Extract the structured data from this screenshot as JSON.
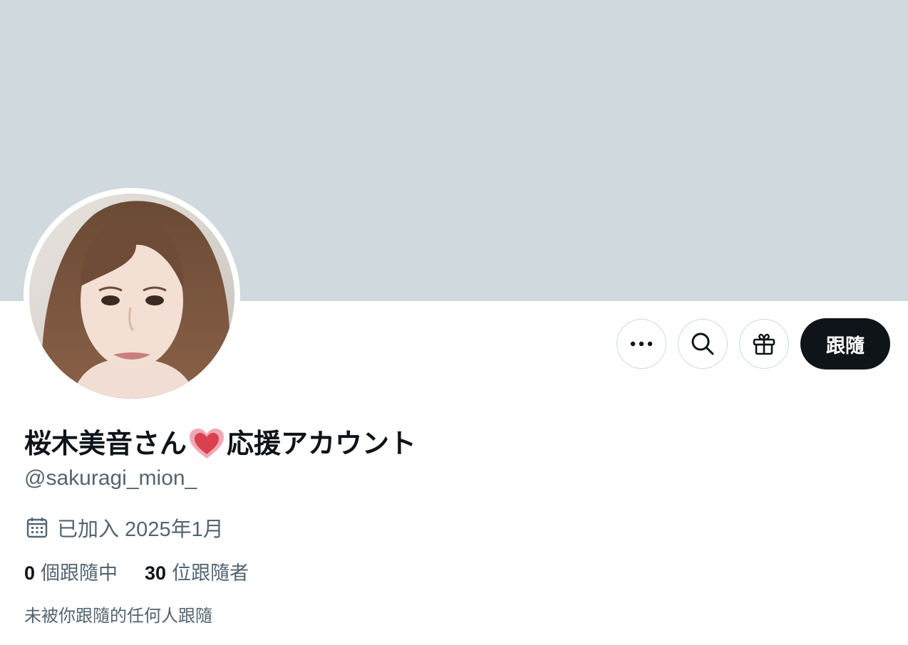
{
  "profile": {
    "display_name_before": "桜木美音さん",
    "display_name_after": "応援アカウント",
    "handle": "@sakuragi_mion_",
    "joined": "已加入 2025年1月",
    "following_count": "0",
    "following_label": "個跟隨中",
    "followers_count": "30",
    "followers_label": "位跟隨者",
    "not_followed_note": "未被你跟隨的任何人跟隨"
  },
  "actions": {
    "more_icon": "more-horizontal-icon",
    "search_icon": "search-icon",
    "gift_icon": "gift-icon",
    "follow_label": "跟隨"
  },
  "colors": {
    "banner": "#cfd9de",
    "text_primary": "#0f1419",
    "text_secondary": "#536471",
    "button_dark": "#0f1419"
  }
}
